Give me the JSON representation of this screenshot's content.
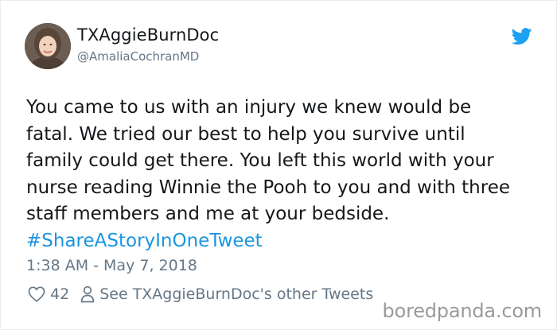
{
  "tweet": {
    "display_name": "TXAggieBurnDoc",
    "handle": "@AmaliaCochranMD",
    "body_text": "You came to us with an injury we knew would be\nfatal. We tried our best to help you survive until\nfamily could get there. You left this world with your\nnurse reading Winnie the Pooh to you and with three\nstaff members and me at your bedside.",
    "hashtag": "#ShareAStoryInOneTweet",
    "timestamp": "1:38 AM - May 7, 2018",
    "like_count": "42",
    "see_other_label": "See TXAggieBurnDoc's other Tweets"
  },
  "icons": {
    "brand": "twitter-bird-icon",
    "like": "heart-icon",
    "profile": "person-icon"
  },
  "watermark": "boredpanda.com",
  "colors": {
    "twitter_blue": "#1da1f2",
    "hashtag": "#1b95e0",
    "muted": "#657786",
    "text": "#14171a"
  }
}
